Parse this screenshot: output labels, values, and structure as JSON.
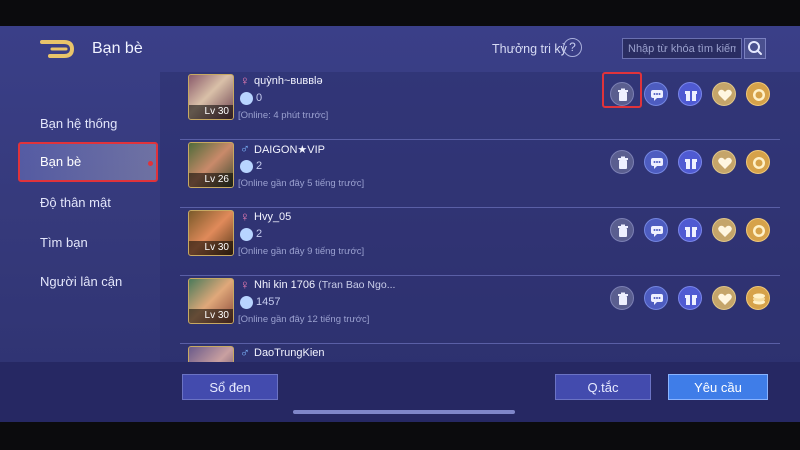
{
  "header": {
    "title": "Bạn bè",
    "rewards_label": "Thưởng tri kỷ",
    "help_label": "?",
    "search_placeholder": "Nhập từ khóa tìm kiếm",
    "icons": [
      "back-arrow-icon",
      "search-icon"
    ]
  },
  "sidebar": {
    "items": [
      {
        "label": "Bạn hệ thống",
        "active": false
      },
      {
        "label": "Bạn bè",
        "active": true
      },
      {
        "label": "Độ thân mật",
        "active": false
      },
      {
        "label": "Tìm bạn",
        "active": false
      },
      {
        "label": "Người lân cận",
        "active": false
      }
    ]
  },
  "friends": [
    {
      "name": "quỳnh~вuввlә",
      "alias": "",
      "gender": "female",
      "level": "Lv 30",
      "intimacy": "0",
      "status": "[Online: 4 phút trước]"
    },
    {
      "name": "DAIGON★VIP",
      "alias": "",
      "gender": "male",
      "level": "Lv 26",
      "intimacy": "2",
      "status": "[Online gần đây 5 tiếng trước]"
    },
    {
      "name": "Hvy_05",
      "alias": "",
      "gender": "female",
      "level": "Lv 30",
      "intimacy": "2",
      "status": "[Online gần đây 9 tiếng trước]"
    },
    {
      "name": "Nhi kin 1706",
      "alias": "(Tran Bao Ngo...",
      "gender": "female",
      "level": "Lv 30",
      "intimacy": "1457",
      "status": "[Online gần đây 12 tiếng trước]"
    },
    {
      "name": "DaoTrungKien",
      "alias": "",
      "gender": "male",
      "level": "",
      "intimacy": "",
      "status": ""
    }
  ],
  "gender_symbols": {
    "female": "♀",
    "male": "♂"
  },
  "actions": [
    "delete-icon",
    "chat-icon",
    "gift-icon",
    "heart-icon",
    "coin-icon"
  ],
  "bottom": {
    "blacklist_label": "Sổ đen",
    "rules_label": "Q.tắc",
    "request_label": "Yêu cầu"
  },
  "colors": {
    "background": "#363a7c",
    "highlight": "#e0333b",
    "primary_button": "#3f7de8"
  }
}
